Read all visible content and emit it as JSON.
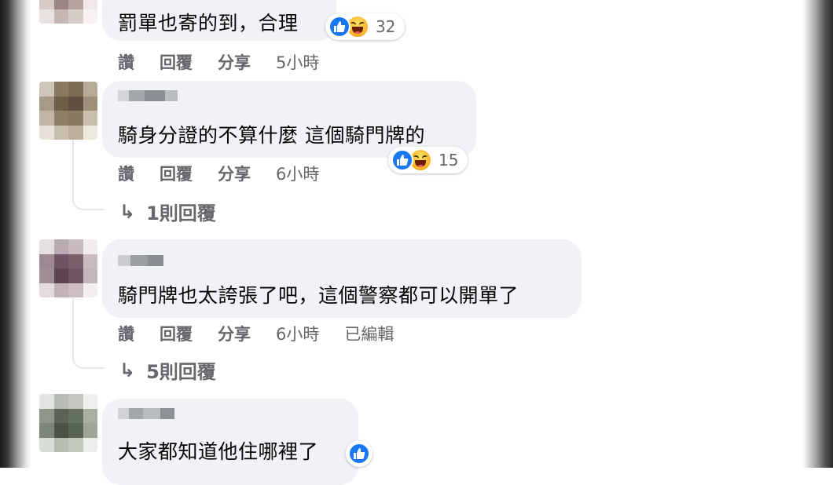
{
  "comments": [
    {
      "text": "罰單也寄的到，合理",
      "reaction_count": "32",
      "reactions": [
        "like-icon",
        "haha-icon"
      ],
      "actions": {
        "like": "讚",
        "reply": "回覆",
        "share": "分享",
        "time": "5小時"
      }
    },
    {
      "text": "騎身分證的不算什麼 這個騎門牌的",
      "reaction_count": "15",
      "reactions": [
        "like-icon",
        "haha-icon"
      ],
      "actions": {
        "like": "讚",
        "reply": "回覆",
        "share": "分享",
        "time": "6小時"
      },
      "replies_link": "1則回覆"
    },
    {
      "text": "騎門牌也太誇張了吧，這個警察都可以開單了",
      "actions": {
        "like": "讚",
        "reply": "回覆",
        "share": "分享",
        "time": "6小時",
        "edited": "已編輯"
      },
      "replies_link": "5則回覆"
    },
    {
      "text": "大家都知道他住哪裡了",
      "reactions": [
        "like-icon"
      ]
    }
  ],
  "icons": {
    "reply_arrow": "↳"
  },
  "colors": {
    "bubble": "#f0f2f5",
    "like_blue": "#1877f2",
    "meta_gray": "#65676b"
  }
}
